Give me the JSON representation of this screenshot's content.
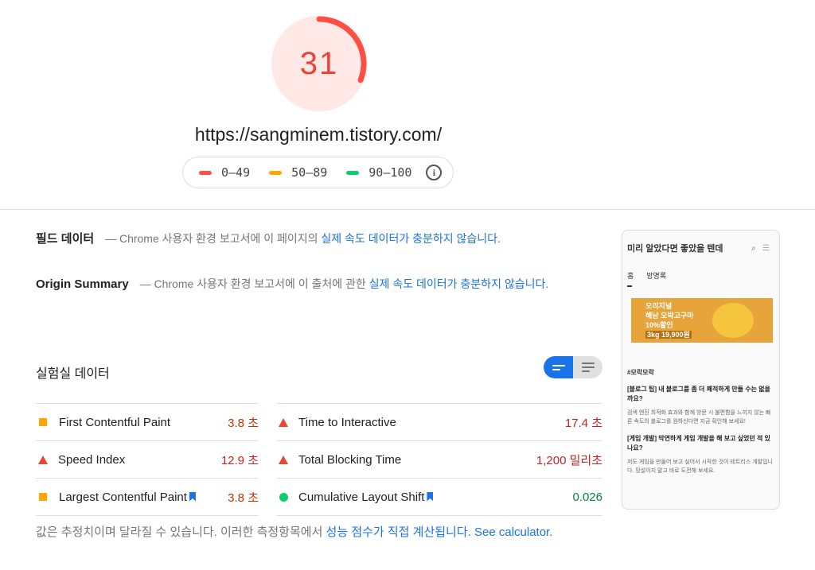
{
  "score": {
    "value": "31",
    "fraction": 0.31,
    "color": "#eb4335"
  },
  "url": "https://sangminem.tistory.com/",
  "legend": [
    {
      "label": "0–49",
      "color": "#ff4e42"
    },
    {
      "label": "50–89",
      "color": "#ffa400"
    },
    {
      "label": "90–100",
      "color": "#0cce6b"
    }
  ],
  "field": {
    "title": "필드 데이터",
    "dash": "—",
    "text": "Chrome 사용자 환경 보고서에 이 페이지의",
    "link": "실제 속도 데이터가 충분하지 않습니다."
  },
  "origin": {
    "title": "Origin Summary",
    "dash": "—",
    "text": "Chrome 사용자 환경 보고서에 이 출처에 관한",
    "link": "실제 속도 데이터가 충분하지 않습니다."
  },
  "lab": {
    "title": "실험실 데이터"
  },
  "metrics": [
    {
      "name": "First Contentful Paint",
      "value": "3.8 초",
      "status": "average",
      "bookmark": false
    },
    {
      "name": "Time to Interactive",
      "value": "17.4 초",
      "status": "fail",
      "bookmark": false
    },
    {
      "name": "Speed Index",
      "value": "12.9 초",
      "status": "fail",
      "bookmark": false
    },
    {
      "name": "Total Blocking Time",
      "value": "1,200 밀리초",
      "status": "fail",
      "bookmark": false
    },
    {
      "name": "Largest Contentful Paint",
      "value": "3.8 초",
      "status": "average",
      "bookmark": true
    },
    {
      "name": "Cumulative Layout Shift",
      "value": "0.026",
      "status": "pass",
      "bookmark": true
    }
  ],
  "status_colors": {
    "fail": "#eb4335",
    "average": "#ffa400",
    "pass": "#0cce6b",
    "fail_text": "#c5221f",
    "average_text": "#c33300",
    "pass_text": "#018642"
  },
  "footer": {
    "text": "값은 추정치이며 달라질 수 있습니다. 이러한 측정항목에서",
    "link": "성능 점수가 직접 계산됩니다.",
    "link2": "See calculator."
  },
  "preview": {
    "blog_title": "미리 알았다면 좋았을 텐데",
    "nav": [
      "홈",
      "방명록"
    ],
    "banner": [
      "오리지널",
      "해남 오박고구마",
      "10%할인",
      "3kg 19,900원"
    ],
    "tag": "#모락모락",
    "posts": [
      {
        "title": "[블로그 팁] 내 블로그를 좀 더 쾌적하게 만들 수는 없을까요?",
        "body": "검색 엔진 최적화 효과와 함께 방문 시 불편함을 느끼지 않는 빠른 속도의 블로그를 원하신다면 지금 확인해 보세요!"
      },
      {
        "title": "[게임 개발] 막연하게 게임 개발을 해 보고 싶었던 적 있나요?",
        "body": "저도 게임을 만들어 보고 싶어서 시작한 것이 테트리스 개발입니다. 망설이지 말고 바로 도전해 보세요."
      }
    ]
  }
}
